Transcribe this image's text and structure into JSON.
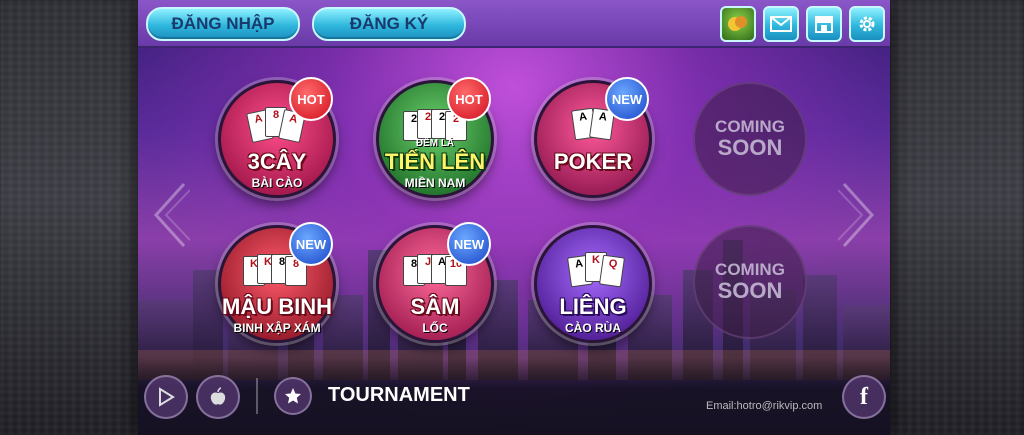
{
  "header": {
    "login_label": "ĐĂNG NHẬP",
    "register_label": "ĐĂNG KÝ",
    "icons": [
      "game-icon",
      "mail-icon",
      "shop-icon",
      "settings-icon"
    ]
  },
  "games": [
    {
      "title": "3CÂY",
      "subtitle": "BÀI CÀO",
      "badge": "HOT"
    },
    {
      "title": "TIẾN LÊN",
      "subtitle": "MIỀN NAM",
      "tagline": "ĐẾM LÁ",
      "badge": "HOT"
    },
    {
      "title": "POKER",
      "subtitle": "",
      "badge": "NEW"
    },
    {
      "title": "MẬU BINH",
      "subtitle": "BINH XẬP XÁM",
      "badge": "NEW"
    },
    {
      "title": "SÂM",
      "subtitle": "LỐC",
      "badge": "NEW"
    },
    {
      "title": "LIÊNG",
      "subtitle": "CÀO RÙA",
      "badge": ""
    }
  ],
  "coming_soon": [
    {
      "line1": "COMING",
      "line2": "SOON"
    },
    {
      "line1": "COMING",
      "line2": "SOON"
    }
  ],
  "footer": {
    "tournament_label": "TOURNAMENT",
    "email": "Email:hotro@rikvip.com"
  },
  "colors": {
    "accent": "#2fb7dd",
    "hot": "#d11020",
    "new": "#1a46c8"
  }
}
